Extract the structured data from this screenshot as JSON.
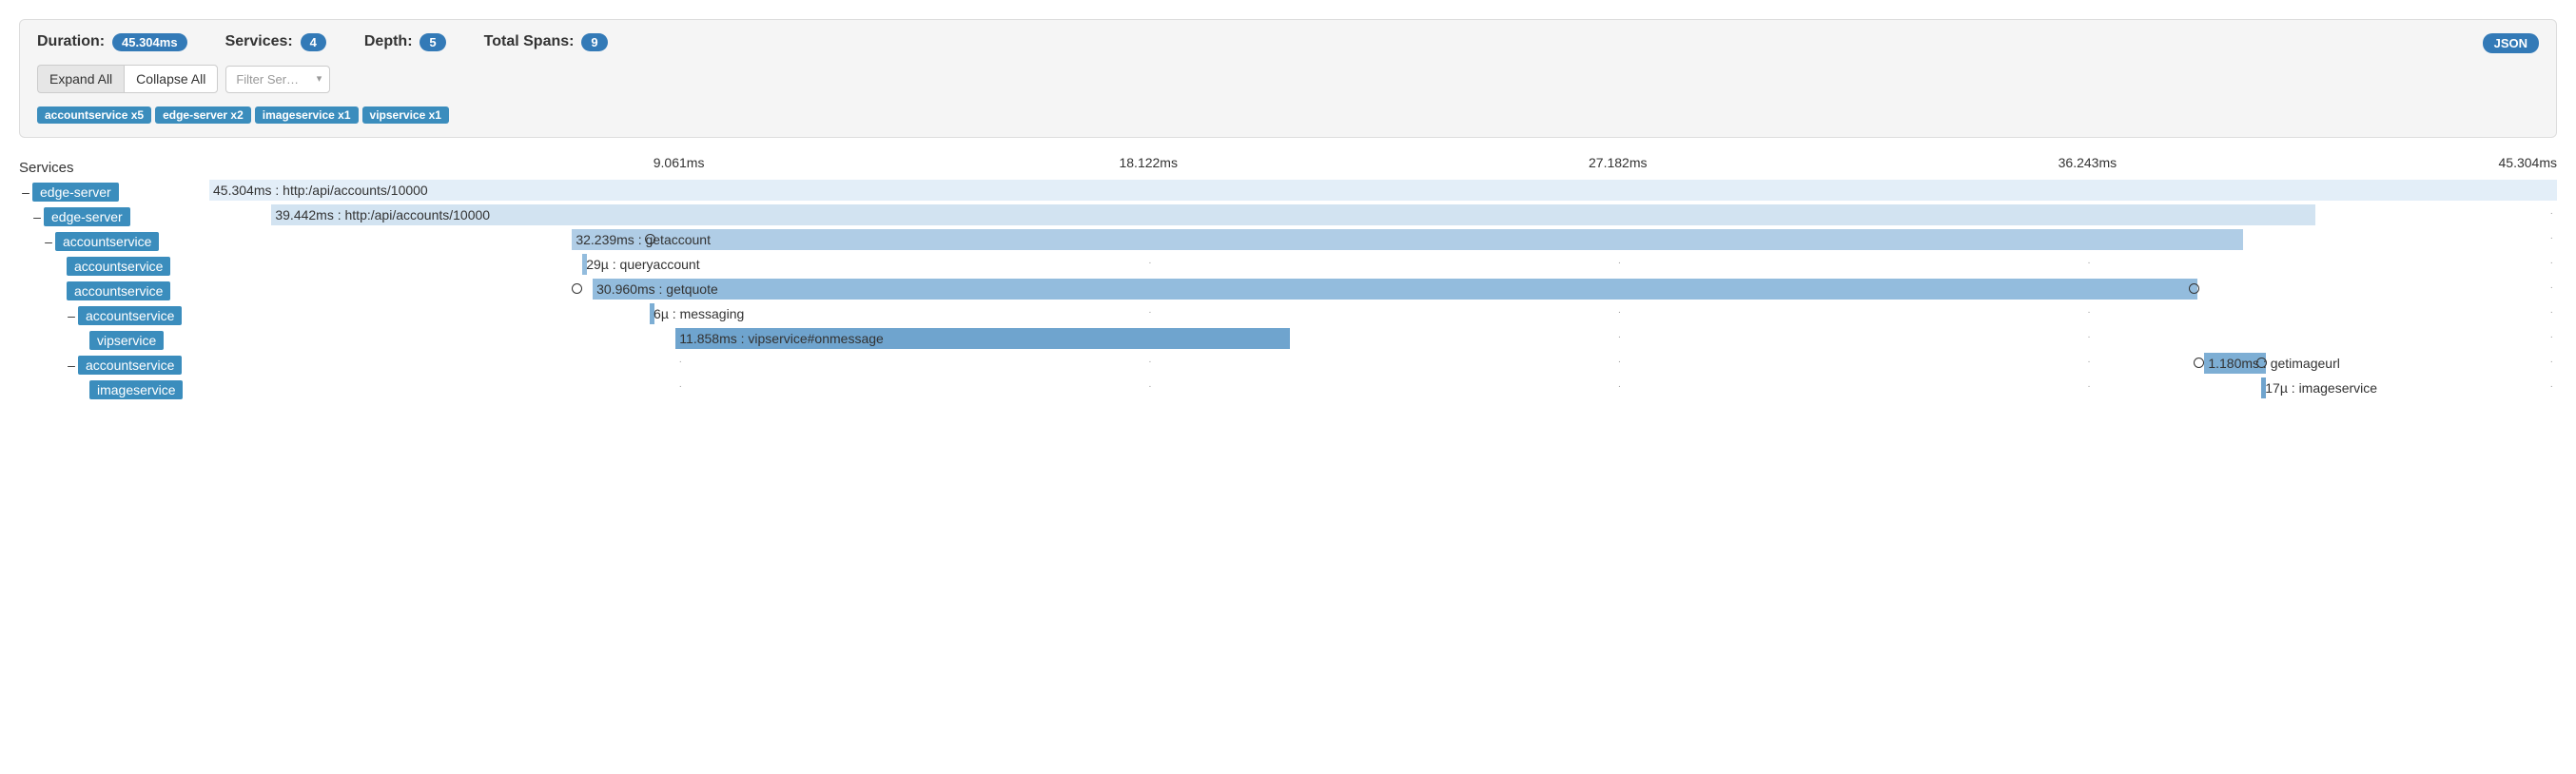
{
  "panel": {
    "duration_label": "Duration:",
    "duration_value": "45.304ms",
    "services_label": "Services:",
    "services_count": "4",
    "depth_label": "Depth:",
    "depth_value": "5",
    "total_spans_label": "Total Spans:",
    "total_spans_value": "9",
    "expand_all": "Expand All",
    "collapse_all": "Collapse All",
    "filter_placeholder": "Filter Ser…",
    "json_btn": "JSON",
    "service_counts": [
      "accountservice x5",
      "edge-server x2",
      "imageservice x1",
      "vipservice x1"
    ]
  },
  "header": {
    "services_col": "Services",
    "ticks": [
      "9.061ms",
      "18.122ms",
      "27.182ms",
      "36.243ms",
      "45.304ms"
    ]
  },
  "chart_data": {
    "type": "gantt",
    "total_ms": 45.304,
    "tick_ms": [
      9.061,
      18.122,
      27.182,
      36.243,
      45.304
    ],
    "spans": [
      {
        "depth": 0,
        "toggle": true,
        "service": "edge-server",
        "start_ms": 0.0,
        "dur_ms": 45.304,
        "label": "45.304ms : http:/api/accounts/10000",
        "shade": 0,
        "circles": []
      },
      {
        "depth": 1,
        "toggle": true,
        "service": "edge-server",
        "start_ms": 1.2,
        "dur_ms": 39.442,
        "label": "39.442ms : http:/api/accounts/10000",
        "shade": 1,
        "circles": []
      },
      {
        "depth": 2,
        "toggle": true,
        "service": "accountservice",
        "start_ms": 7.0,
        "dur_ms": 32.239,
        "label": "32.239ms : getaccount",
        "shade": 2,
        "circles": [
          8.4
        ]
      },
      {
        "depth": 3,
        "toggle": false,
        "service": "accountservice",
        "start_ms": 7.2,
        "dur_ms": 0.029,
        "label": "29µ : queryaccount",
        "shade": 3,
        "circles": []
      },
      {
        "depth": 3,
        "toggle": false,
        "service": "accountservice",
        "start_ms": 7.4,
        "dur_ms": 30.96,
        "label": "30.960ms : getquote",
        "shade": 3,
        "circles": [
          7.0,
          38.2
        ]
      },
      {
        "depth": 4,
        "toggle": true,
        "service": "accountservice",
        "start_ms": 8.5,
        "dur_ms": 0.006,
        "label": "6µ : messaging",
        "shade": 4,
        "circles": []
      },
      {
        "depth": 5,
        "toggle": false,
        "service": "vipservice",
        "start_ms": 9.0,
        "dur_ms": 11.858,
        "label": "11.858ms : vipservice#onmessage",
        "shade": 5,
        "circles": []
      },
      {
        "depth": 4,
        "toggle": true,
        "service": "accountservice",
        "start_ms": 38.5,
        "dur_ms": 1.18,
        "label": "1.180ms : getimageurl",
        "shade": 4,
        "circles": [
          38.3,
          39.5
        ]
      },
      {
        "depth": 5,
        "toggle": false,
        "service": "imageservice",
        "start_ms": 39.6,
        "dur_ms": 0.017,
        "label": "17µ : imageservice",
        "shade": 5,
        "circles": []
      }
    ]
  }
}
